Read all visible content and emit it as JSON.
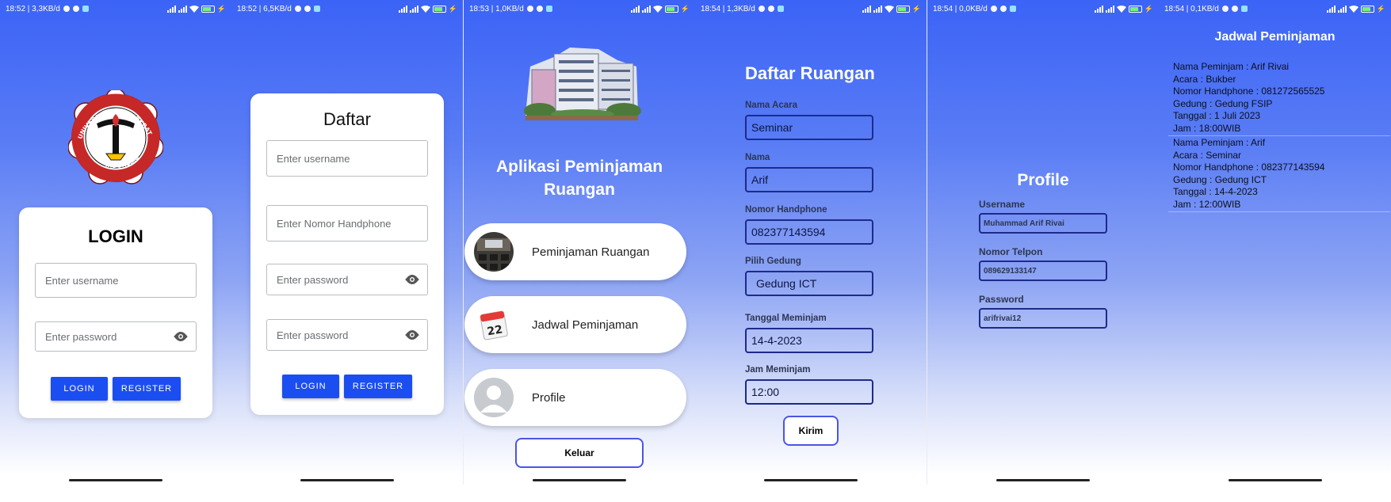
{
  "screens": [
    {
      "status": {
        "time": "18:52 | 3,3KB/d"
      },
      "logo_text": {
        "top": "UNIVERSITAS TEKNOKRAT",
        "bottom": "INDONESIA"
      },
      "title": "LOGIN",
      "username_placeholder": "Enter username",
      "password_placeholder": "Enter password",
      "login_label": "LOGIN",
      "register_label": "REGISTER"
    },
    {
      "status": {
        "time": "18:52 | 6,5KB/d"
      },
      "title": "Daftar",
      "username_placeholder": "Enter username",
      "phone_placeholder": "Enter Nomor Handphone",
      "password_placeholder": "Enter password",
      "password2_placeholder": "Enter password",
      "login_label": "LOGIN",
      "register_label": "REGISTER"
    },
    {
      "status": {
        "time": "18:53 | 1,0KB/d"
      },
      "title_line1": "Aplikasi Peminjaman",
      "title_line2": "Ruangan",
      "menu": [
        {
          "label": "Peminjaman Ruangan",
          "icon": "classroom-photo-icon"
        },
        {
          "label": "Jadwal Peminjaman",
          "icon": "calendar-icon"
        },
        {
          "label": "Profile",
          "icon": "user-avatar-icon"
        }
      ],
      "logout_label": "Keluar"
    },
    {
      "status": {
        "time": "18:54 | 1,3KB/d"
      },
      "title": "Daftar Ruangan",
      "fields": [
        {
          "label": "Nama Acara",
          "value": "Seminar"
        },
        {
          "label": "Nama",
          "value": "Arif"
        },
        {
          "label": "Nomor Handphone",
          "value": "082377143594"
        },
        {
          "label": "Pilih Gedung",
          "value": "Gedung ICT"
        },
        {
          "label": "Tanggal Meminjam",
          "value": "14-4-2023"
        },
        {
          "label": "Jam Meminjam",
          "value": "12:00"
        }
      ],
      "submit_label": "Kirim"
    },
    {
      "status": {
        "time": "18:54 | 0,0KB/d"
      },
      "title": "Profile",
      "username_label": "Username",
      "username_value": "Muhammad Arif Rivai",
      "phone_label": "Nomor Telpon",
      "phone_value": "089629133147",
      "password_label": "Password",
      "password_value": "arifrivai12"
    },
    {
      "status": {
        "time": "18:54 | 0,1KB/d"
      },
      "title": "Jadwal Peminjaman",
      "entries": [
        {
          "peminjam": "Nama Peminjam : Arif Rivai",
          "acara": "Acara : Bukber",
          "hp": "Nomor Handphone : 081272565525",
          "gedung": "Gedung : Gedung FSIP",
          "tanggal": "Tanggal : 1 Juli 2023",
          "jam": "Jam : 18:00WIB"
        },
        {
          "peminjam": "Nama Peminjam : Arif",
          "acara": "Acara : Seminar",
          "hp": "Nomor Handphone : 082377143594",
          "gedung": "Gedung : Gedung ICT",
          "tanggal": "Tanggal : 14-4-2023",
          "jam": "Jam : 12:00WIB"
        }
      ]
    }
  ],
  "colors": {
    "primary_button": "#1b4ef0",
    "gradient_top": "#3b63f6",
    "outline_button": "#4b55e6",
    "input_border": "#1e2a8a"
  }
}
